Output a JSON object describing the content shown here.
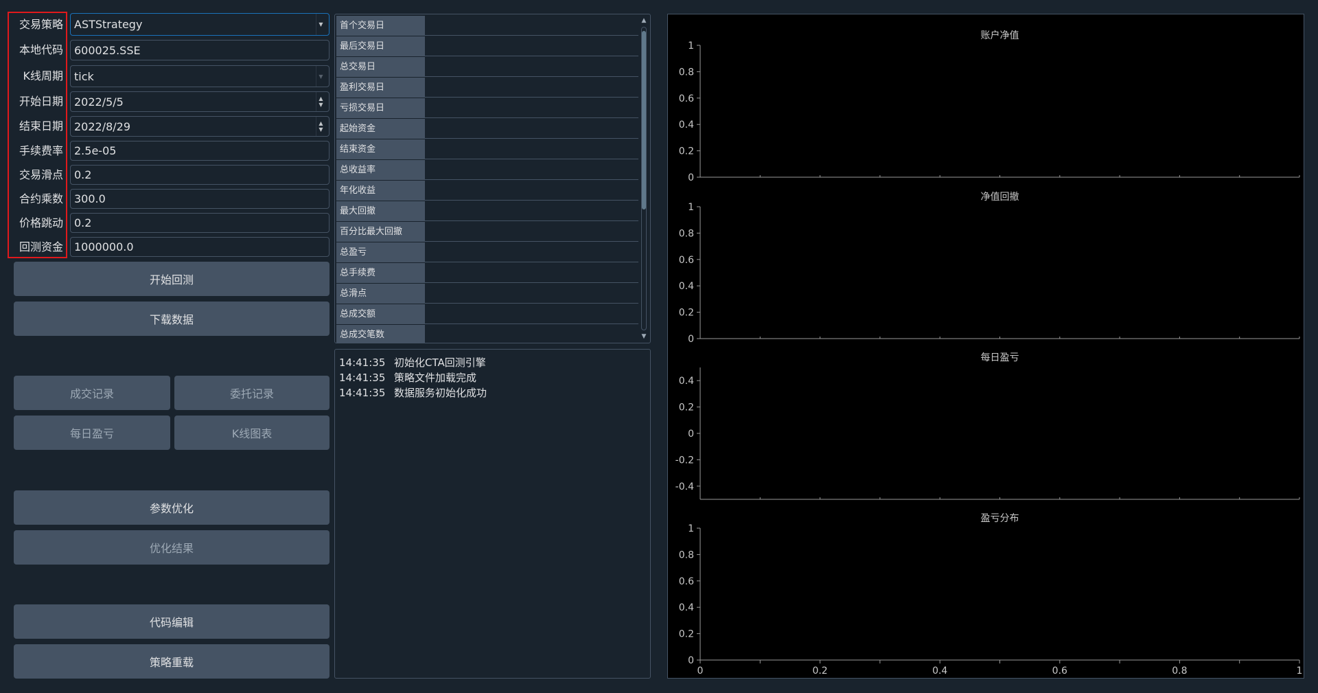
{
  "form": {
    "fields": [
      {
        "label": "交易策略",
        "value": "ASTStrategy",
        "kind": "combo"
      },
      {
        "label": "本地代码",
        "value": "600025.SSE",
        "kind": "text"
      },
      {
        "label": "K线周期",
        "value": "tick",
        "kind": "combo-disabled"
      },
      {
        "label": "开始日期",
        "value": "2022/5/5",
        "kind": "date"
      },
      {
        "label": "结束日期",
        "value": "2022/8/29",
        "kind": "date"
      },
      {
        "label": "手续费率",
        "value": "2.5e-05",
        "kind": "text"
      },
      {
        "label": "交易滑点",
        "value": "0.2",
        "kind": "text"
      },
      {
        "label": "合约乘数",
        "value": "300.0",
        "kind": "text"
      },
      {
        "label": "价格跳动",
        "value": "0.2",
        "kind": "text"
      },
      {
        "label": "回测资金",
        "value": "1000000.0",
        "kind": "text"
      }
    ]
  },
  "buttons": {
    "start_backtest": "开始回测",
    "download_data": "下载数据",
    "trade_records": "成交记录",
    "order_records": "委托记录",
    "daily_pnl": "每日盈亏",
    "kline_chart": "K线图表",
    "param_optimize": "参数优化",
    "optimize_result": "优化结果",
    "code_edit": "代码编辑",
    "strategy_reload": "策略重载"
  },
  "stats": {
    "rows": [
      "首个交易日",
      "最后交易日",
      "总交易日",
      "盈利交易日",
      "亏损交易日",
      "起始资金",
      "结束资金",
      "总收益率",
      "年化收益",
      "最大回撤",
      "百分比最大回撤",
      "总盈亏",
      "总手续费",
      "总滑点",
      "总成交额",
      "总成交笔数"
    ]
  },
  "log": {
    "lines": [
      {
        "time": "14:41:35",
        "msg": "初始化CTA回测引擎"
      },
      {
        "time": "14:41:35",
        "msg": "策略文件加载完成"
      },
      {
        "time": "14:41:35",
        "msg": "数据服务初始化成功"
      }
    ]
  },
  "charts": {
    "titles": [
      "账户净值",
      "净值回撤",
      "每日盈亏",
      "盈亏分布"
    ],
    "axis_color": "#9a9a9a",
    "y_ticks_unit": [
      "0",
      "0.2",
      "0.4",
      "0.6",
      "0.8",
      "1"
    ],
    "y_ticks_pnl": [
      "-0.4",
      "-0.2",
      "0",
      "0.2",
      "0.4"
    ],
    "x_ticks": [
      "0",
      "0.2",
      "0.4",
      "0.6",
      "0.8",
      "1"
    ]
  },
  "chart_data": [
    {
      "type": "line",
      "title": "账户净值",
      "ylim": [
        0,
        1
      ],
      "series": []
    },
    {
      "type": "line",
      "title": "净值回撤",
      "ylim": [
        0,
        1
      ],
      "series": []
    },
    {
      "type": "bar",
      "title": "每日盈亏",
      "ylim": [
        -0.5,
        0.5
      ],
      "series": []
    },
    {
      "type": "bar",
      "title": "盈亏分布",
      "ylim": [
        0,
        1
      ],
      "xlim": [
        0,
        1
      ],
      "series": []
    }
  ]
}
